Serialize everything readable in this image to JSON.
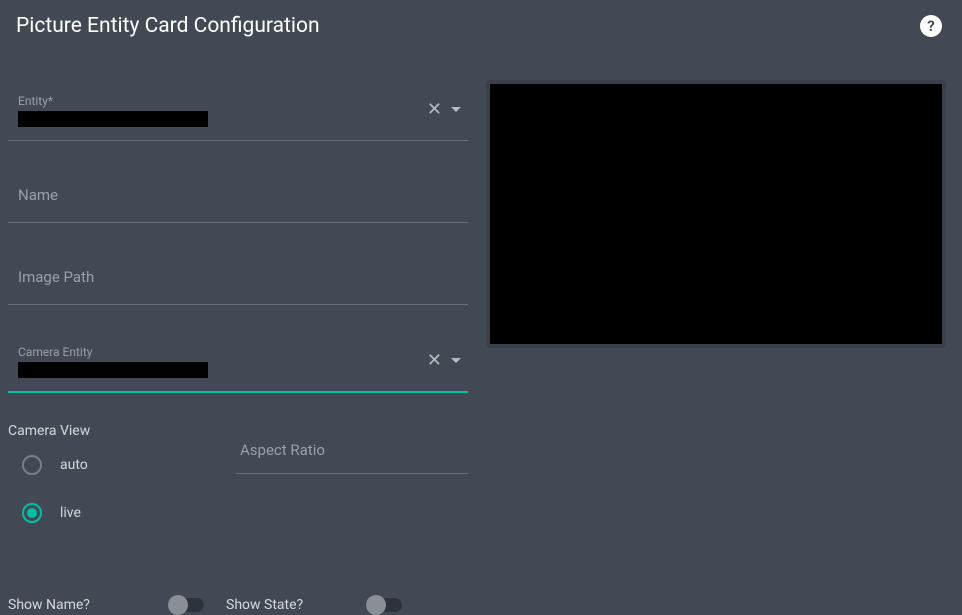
{
  "header": {
    "title": "Picture Entity Card Configuration",
    "help_icon": "?"
  },
  "fields": {
    "entity_label": "Entity*",
    "entity_value": "",
    "name_label": "Name",
    "image_path_label": "Image Path",
    "camera_entity_label": "Camera Entity",
    "camera_entity_value": ""
  },
  "camera_view": {
    "section_label": "Camera View",
    "options": {
      "auto": "auto",
      "live": "live"
    },
    "selected": "live"
  },
  "aspect_ratio_label": "Aspect Ratio",
  "toggles": {
    "show_name_label": "Show Name?",
    "show_state_label": "Show State?",
    "show_name_value": false,
    "show_state_value": false
  }
}
